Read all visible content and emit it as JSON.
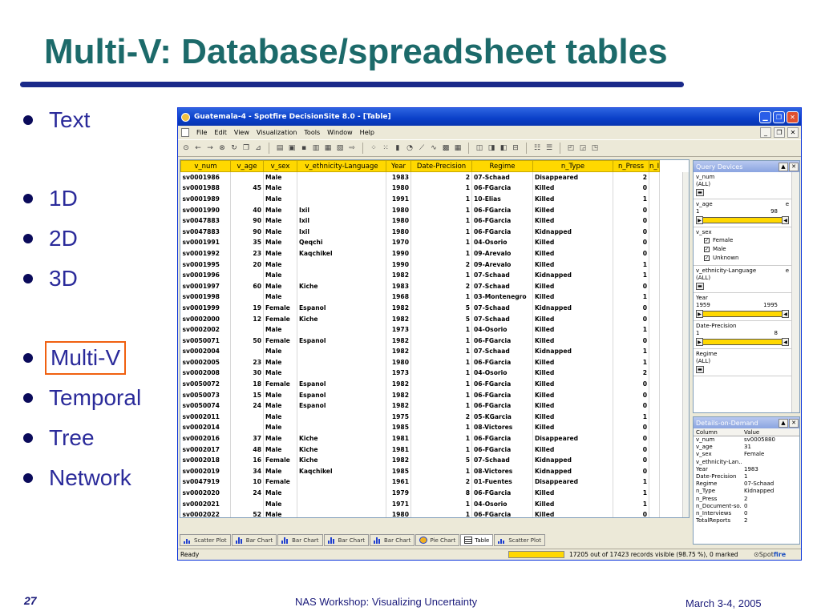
{
  "slide": {
    "title": "Multi-V: Database/spreadsheet tables",
    "bullets": [
      "Text",
      "1D",
      "2D",
      "3D",
      "Multi-V",
      "Temporal",
      "Tree",
      "Network"
    ],
    "highlighted_bullet": "Multi-V",
    "footer": {
      "page": "27",
      "center": "NAS Workshop: Visualizing Uncertainty",
      "right": "March 3-4, 2005"
    },
    "colors": {
      "title": "#1c6a6a",
      "rule": "#1a2a8a",
      "bullet_text": "#2a2a9a",
      "highlight_box": "#f06010"
    }
  },
  "app": {
    "title": "Guatemala-4 - Spotfire DecisionSite 8.0 - [Table]",
    "menu": [
      "File",
      "Edit",
      "View",
      "Visualization",
      "Tools",
      "Window",
      "Help"
    ],
    "table": {
      "columns": [
        "v_num",
        "v_age",
        "v_sex",
        "v_ethnicity-Language",
        "Year",
        "Date-Precision",
        "Regime",
        "n_Type",
        "n_Press",
        "n_I"
      ],
      "rows": [
        [
          "sv0001986",
          "",
          "Male",
          "",
          "1983",
          "2",
          "07-Schaad",
          "Disappeared",
          "2"
        ],
        [
          "sv0001988",
          "45",
          "Male",
          "",
          "1980",
          "1",
          "06-FGarcia",
          "Killed",
          "0"
        ],
        [
          "sv0001989",
          "",
          "Male",
          "",
          "1991",
          "1",
          "10-Elias",
          "Killed",
          "1"
        ],
        [
          "sv0001990",
          "40",
          "Male",
          "Ixil",
          "1980",
          "1",
          "06-FGarcia",
          "Killed",
          "0"
        ],
        [
          "sv0047883",
          "90",
          "Male",
          "Ixil",
          "1980",
          "1",
          "06-FGarcia",
          "Killed",
          "0"
        ],
        [
          "sv0047883",
          "90",
          "Male",
          "Ixil",
          "1980",
          "1",
          "06-FGarcia",
          "Kidnapped",
          "0"
        ],
        [
          "sv0001991",
          "35",
          "Male",
          "Qeqchi",
          "1970",
          "1",
          "04-Osorio",
          "Killed",
          "0"
        ],
        [
          "sv0001992",
          "23",
          "Male",
          "Kaqchikel",
          "1990",
          "1",
          "09-Arevalo",
          "Killed",
          "0"
        ],
        [
          "sv0001995",
          "20",
          "Male",
          "",
          "1990",
          "2",
          "09-Arevalo",
          "Killed",
          "1"
        ],
        [
          "sv0001996",
          "",
          "Male",
          "",
          "1982",
          "1",
          "07-Schaad",
          "Kidnapped",
          "1"
        ],
        [
          "sv0001997",
          "60",
          "Male",
          "Kiche",
          "1983",
          "2",
          "07-Schaad",
          "Killed",
          "0"
        ],
        [
          "sv0001998",
          "",
          "Male",
          "",
          "1968",
          "1",
          "03-Montenegro",
          "Killed",
          "1"
        ],
        [
          "sv0001999",
          "19",
          "Female",
          "Espanol",
          "1982",
          "5",
          "07-Schaad",
          "Kidnapped",
          "0"
        ],
        [
          "sv0002000",
          "12",
          "Female",
          "Kiche",
          "1982",
          "5",
          "07-Schaad",
          "Killed",
          "0"
        ],
        [
          "sv0002002",
          "",
          "Male",
          "",
          "1973",
          "1",
          "04-Osorio",
          "Killed",
          "1"
        ],
        [
          "sv0050071",
          "50",
          "Female",
          "Espanol",
          "1982",
          "1",
          "06-FGarcia",
          "Killed",
          "0"
        ],
        [
          "sv0002004",
          "",
          "Male",
          "",
          "1982",
          "1",
          "07-Schaad",
          "Kidnapped",
          "1"
        ],
        [
          "sv0002005",
          "23",
          "Male",
          "",
          "1980",
          "1",
          "06-FGarcia",
          "Killed",
          "1"
        ],
        [
          "sv0002008",
          "30",
          "Male",
          "",
          "1973",
          "1",
          "04-Osorio",
          "Killed",
          "2"
        ],
        [
          "sv0050072",
          "18",
          "Female",
          "Espanol",
          "1982",
          "1",
          "06-FGarcia",
          "Killed",
          "0"
        ],
        [
          "sv0050073",
          "15",
          "Male",
          "Espanol",
          "1982",
          "1",
          "06-FGarcia",
          "Killed",
          "0"
        ],
        [
          "sv0050074",
          "24",
          "Male",
          "Espanol",
          "1982",
          "1",
          "06-FGarcia",
          "Killed",
          "0"
        ],
        [
          "sv0002011",
          "",
          "Male",
          "",
          "1975",
          "2",
          "05-KGarcia",
          "Killed",
          "1"
        ],
        [
          "sv0002014",
          "",
          "Male",
          "",
          "1985",
          "1",
          "08-Victores",
          "Killed",
          "0"
        ],
        [
          "sv0002016",
          "37",
          "Male",
          "Kiche",
          "1981",
          "1",
          "06-FGarcia",
          "Disappeared",
          "0"
        ],
        [
          "sv0002017",
          "48",
          "Male",
          "Kiche",
          "1981",
          "1",
          "06-FGarcia",
          "Killed",
          "0"
        ],
        [
          "sv0002018",
          "16",
          "Female",
          "Kiche",
          "1982",
          "5",
          "07-Schaad",
          "Kidnapped",
          "0"
        ],
        [
          "sv0002019",
          "34",
          "Male",
          "Kaqchikel",
          "1985",
          "1",
          "08-Victores",
          "Kidnapped",
          "0"
        ],
        [
          "sv0047919",
          "10",
          "Female",
          "",
          "1961",
          "2",
          "01-Fuentes",
          "Disappeared",
          "1"
        ],
        [
          "sv0002020",
          "24",
          "Male",
          "",
          "1979",
          "8",
          "06-FGarcia",
          "Killed",
          "1"
        ],
        [
          "sv0002021",
          "",
          "Male",
          "",
          "1971",
          "1",
          "04-Osorio",
          "Killed",
          "1"
        ],
        [
          "sv0002022",
          "52",
          "Male",
          "",
          "1980",
          "1",
          "06-FGarcia",
          "Killed",
          "0"
        ]
      ]
    },
    "query_devices": {
      "title": "Query Devices",
      "v_num": {
        "label": "v_num",
        "value": "(ALL)"
      },
      "v_age": {
        "label": "v_age",
        "flag": "e",
        "min": "1",
        "max": "98"
      },
      "v_sex": {
        "label": "v_sex",
        "options": [
          "Female",
          "Male",
          "Unknown"
        ]
      },
      "v_ethnicity": {
        "label": "v_ethnicity-Language",
        "flag": "e",
        "value": "(ALL)"
      },
      "year": {
        "label": "Year",
        "min": "1959",
        "max": "1995"
      },
      "date_precision": {
        "label": "Date-Precision",
        "min": "1",
        "max": "8"
      },
      "regime": {
        "label": "Regime",
        "value": "(ALL)"
      }
    },
    "details": {
      "title": "Details-on-Demand",
      "head": [
        "Column",
        "Value"
      ],
      "rows": [
        [
          "v_num",
          "sv0005880"
        ],
        [
          "v_age",
          "31"
        ],
        [
          "v_sex",
          "Female"
        ],
        [
          "v_ethnicity-Lan...",
          ""
        ],
        [
          "Year",
          "1983"
        ],
        [
          "Date-Precision",
          "1"
        ],
        [
          "Regime",
          "07-Schaad"
        ],
        [
          "n_Type",
          "Kidnapped"
        ],
        [
          "n_Press",
          "2"
        ],
        [
          "n_Document-so...",
          "0"
        ],
        [
          "n_Interviews",
          "0"
        ],
        [
          "TotalReports",
          "2"
        ]
      ]
    },
    "tabs": [
      "Scatter Plot",
      "Bar Chart",
      "Bar Chart",
      "Bar Chart",
      "Bar Chart",
      "Pie Chart",
      "Table",
      "Scatter Plot"
    ],
    "active_tab": "Table",
    "status": {
      "ready": "Ready",
      "records": "17205 out of 17423 records visible (98.75 %), 0 marked",
      "logo_a": "Spot",
      "logo_b": "fire"
    }
  }
}
